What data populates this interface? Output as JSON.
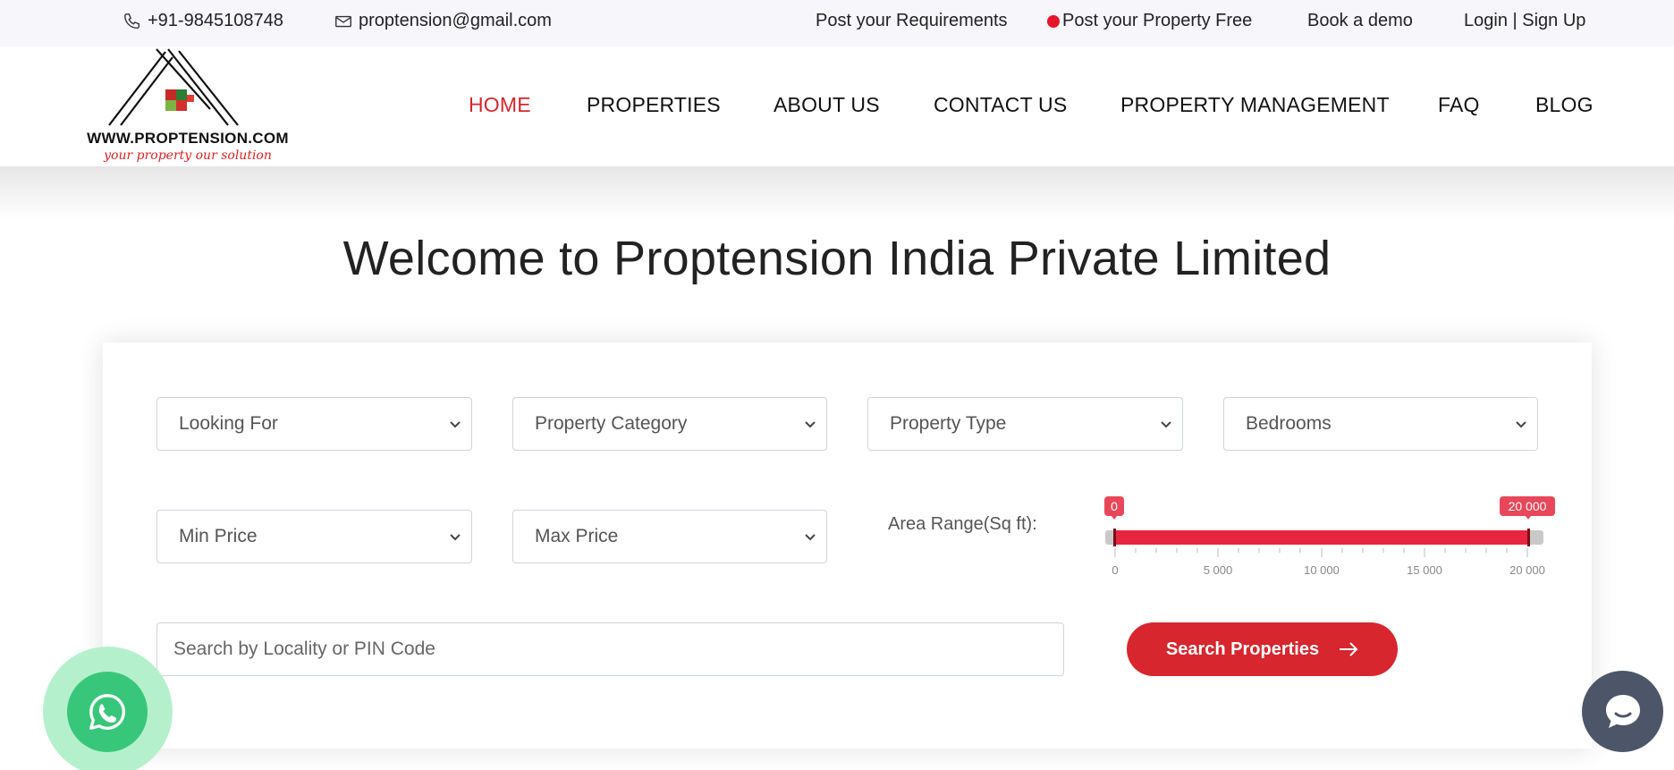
{
  "topbar": {
    "phone": "+91-9845108748",
    "email": "proptension@gmail.com",
    "post_requirements": "Post your Requirements",
    "post_property": "Post your Property Free",
    "book_demo": "Book a demo",
    "login_signup": "Login | Sign Up"
  },
  "logo": {
    "site": "WWW.PROPTENSION.COM",
    "tagline": "your property our solution"
  },
  "nav": {
    "items": [
      "HOME",
      "PROPERTIES",
      "ABOUT US",
      "CONTACT US",
      "PROPERTY MANAGEMENT",
      "FAQ",
      "BLOG"
    ],
    "active": "HOME"
  },
  "title": "Welcome to Proptension India Private Limited",
  "search": {
    "looking_for": "Looking For",
    "property_category": "Property Category",
    "property_type": "Property Type",
    "bedrooms": "Bedrooms",
    "min_price": "Min Price",
    "max_price": "Max Price",
    "area_label": "Area Range(Sq ft):",
    "locality_placeholder": "Search by Locality or PIN Code",
    "submit": "Search Properties"
  },
  "area_range": {
    "min_value": 0,
    "max_value": 20000,
    "min_label": "0",
    "max_label": "20 000",
    "ticks": [
      "0",
      "5 000",
      "10 000",
      "15 000",
      "20 000"
    ]
  },
  "colors": {
    "accent": "#d7262d",
    "slider": "#e8253f",
    "whatsapp": "#38c77a",
    "chat": "#4d5668"
  },
  "icons": {
    "phone": "phone-icon",
    "email": "mail-icon",
    "whatsapp": "whatsapp-icon",
    "chat": "chat-icon"
  }
}
